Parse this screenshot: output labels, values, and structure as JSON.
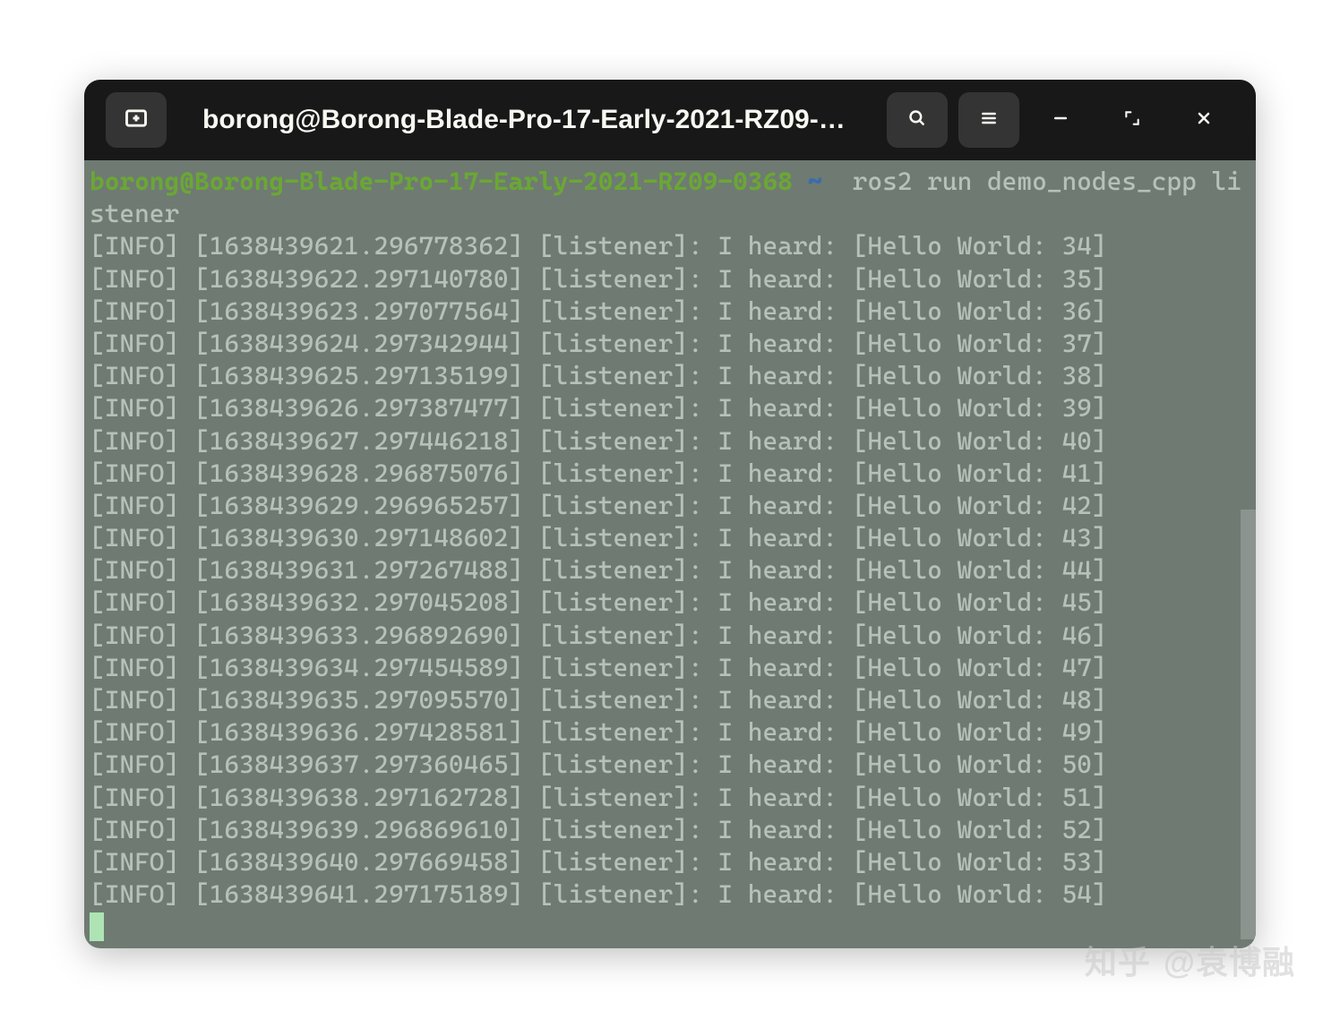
{
  "titlebar": {
    "title": "borong@Borong-Blade-Pro-17-Early-2021-RZ09-0368…"
  },
  "prompt": {
    "user_host": "borong@Borong-Blade-Pro-17-Early-2021-RZ09-0368",
    "colon": ":",
    "tilde": "~",
    "dollar": "$",
    "command": " ros2 run demo_nodes_cpp listener"
  },
  "log_lines": [
    "[INFO] [1638439621.296778362] [listener]: I heard: [Hello World: 34]",
    "[INFO] [1638439622.297140780] [listener]: I heard: [Hello World: 35]",
    "[INFO] [1638439623.297077564] [listener]: I heard: [Hello World: 36]",
    "[INFO] [1638439624.297342944] [listener]: I heard: [Hello World: 37]",
    "[INFO] [1638439625.297135199] [listener]: I heard: [Hello World: 38]",
    "[INFO] [1638439626.297387477] [listener]: I heard: [Hello World: 39]",
    "[INFO] [1638439627.297446218] [listener]: I heard: [Hello World: 40]",
    "[INFO] [1638439628.296875076] [listener]: I heard: [Hello World: 41]",
    "[INFO] [1638439629.296965257] [listener]: I heard: [Hello World: 42]",
    "[INFO] [1638439630.297148602] [listener]: I heard: [Hello World: 43]",
    "[INFO] [1638439631.297267488] [listener]: I heard: [Hello World: 44]",
    "[INFO] [1638439632.297045208] [listener]: I heard: [Hello World: 45]",
    "[INFO] [1638439633.296892690] [listener]: I heard: [Hello World: 46]",
    "[INFO] [1638439634.297454589] [listener]: I heard: [Hello World: 47]",
    "[INFO] [1638439635.297095570] [listener]: I heard: [Hello World: 48]",
    "[INFO] [1638439636.297428581] [listener]: I heard: [Hello World: 49]",
    "[INFO] [1638439637.297360465] [listener]: I heard: [Hello World: 50]",
    "[INFO] [1638439638.297162728] [listener]: I heard: [Hello World: 51]",
    "[INFO] [1638439639.296869610] [listener]: I heard: [Hello World: 52]",
    "[INFO] [1638439640.297669458] [listener]: I heard: [Hello World: 53]",
    "[INFO] [1638439641.297175189] [listener]: I heard: [Hello World: 54]"
  ],
  "watermark": {
    "site": "知乎",
    "at": "@袁博融"
  }
}
